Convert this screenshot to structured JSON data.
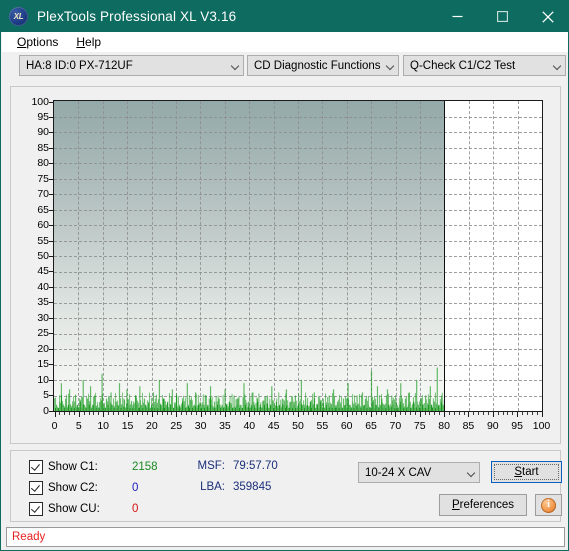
{
  "window": {
    "title": "PlexTools Professional XL V3.16",
    "logo_text": "XL",
    "minimize_label": "minimize",
    "maximize_label": "maximize",
    "close_label": "close"
  },
  "menubar": {
    "items": [
      {
        "label": "Options",
        "accel": "O"
      },
      {
        "label": "Help",
        "accel": "H"
      }
    ]
  },
  "toolbar": {
    "drive_select": "HA:8 ID:0  PX-712UF",
    "function_select": "CD Diagnostic Functions",
    "test_select": "Q-Check C1/C2 Test"
  },
  "info": {
    "checkboxes": [
      {
        "label": "Show C1:",
        "value": "2158",
        "checked": true,
        "color": "#1a8a22"
      },
      {
        "label": "Show C2:",
        "value": "0",
        "checked": true,
        "color": "#1b1bbd"
      },
      {
        "label": "Show CU:",
        "value": "0",
        "checked": true,
        "color": "#d41111"
      }
    ],
    "msf_label": "MSF:",
    "msf_value": "79:57.70",
    "lba_label": "LBA:",
    "lba_value": "359845",
    "speed_select": "10-24 X CAV",
    "start_label": "Start",
    "preferences_label": "Preferences",
    "info_icon_label": "i"
  },
  "statusbar": {
    "text": "Ready"
  },
  "chart_data": {
    "type": "bar",
    "title": "",
    "xlabel": "",
    "ylabel": "",
    "xlim": [
      0,
      100
    ],
    "ylim": [
      0,
      100
    ],
    "xticks": [
      0,
      5,
      10,
      15,
      20,
      25,
      30,
      35,
      40,
      45,
      50,
      55,
      60,
      65,
      70,
      75,
      80,
      85,
      90,
      95,
      100
    ],
    "yticks": [
      0,
      5,
      10,
      15,
      20,
      25,
      30,
      35,
      40,
      45,
      50,
      55,
      60,
      65,
      70,
      75,
      80,
      85,
      90,
      95,
      100
    ],
    "grid": true,
    "legend": "none",
    "data_end_x": 80,
    "series": [
      {
        "name": "C1",
        "color": "#1a9a1f",
        "x_unit": "percent of disc",
        "x": [
          0.2,
          0.5,
          0.8,
          1.1,
          1.4,
          1.7,
          2.0,
          2.3,
          2.6,
          2.9,
          3.2,
          3.5,
          3.8,
          4.1,
          4.4,
          4.7,
          5.0,
          5.3,
          5.6,
          5.9,
          6.2,
          6.5,
          6.8,
          7.1,
          7.4,
          7.7,
          8.0,
          8.3,
          8.6,
          8.9,
          9.2,
          9.5,
          9.8,
          10.1,
          10.4,
          10.7,
          11.0,
          11.3,
          11.6,
          11.9,
          12.2,
          12.5,
          12.8,
          13.1,
          13.4,
          13.7,
          14.0,
          14.3,
          14.6,
          14.9,
          15.2,
          15.5,
          15.8,
          16.1,
          16.4,
          16.7,
          17.0,
          17.3,
          17.6,
          17.9,
          18.2,
          18.5,
          18.8,
          19.1,
          19.4,
          19.7,
          20.0,
          20.3,
          20.6,
          20.9,
          21.2,
          21.5,
          21.8,
          22.1,
          22.4,
          22.7,
          23.0,
          23.3,
          23.6,
          23.9,
          24.2,
          24.5,
          24.8,
          25.1,
          25.4,
          25.7,
          26.0,
          26.3,
          26.6,
          26.9,
          27.2,
          27.5,
          27.8,
          28.1,
          28.4,
          28.7,
          29.0,
          29.3,
          29.6,
          29.9,
          30.2,
          30.5,
          30.8,
          31.1,
          31.4,
          31.7,
          32.0,
          32.3,
          32.6,
          32.9,
          33.2,
          33.5,
          33.8,
          34.1,
          34.4,
          34.7,
          35.0,
          35.3,
          35.6,
          35.9,
          36.2,
          36.5,
          36.8,
          37.1,
          37.4,
          37.7,
          38.0,
          38.3,
          38.6,
          38.9,
          39.2,
          39.5,
          39.8,
          40.1,
          40.4,
          40.7,
          41.0,
          41.3,
          41.6,
          41.9,
          42.2,
          42.5,
          42.8,
          43.1,
          43.4,
          43.7,
          44.0,
          44.3,
          44.6,
          44.9,
          45.2,
          45.5,
          45.8,
          46.1,
          46.4,
          46.7,
          47.0,
          47.3,
          47.6,
          47.9,
          48.2,
          48.5,
          48.8,
          49.1,
          49.4,
          49.7,
          50.0,
          50.3,
          50.6,
          50.9,
          51.2,
          51.5,
          51.8,
          52.1,
          52.4,
          52.7,
          53.0,
          53.3,
          53.6,
          53.9,
          54.2,
          54.5,
          54.8,
          55.1,
          55.4,
          55.7,
          56.0,
          56.3,
          56.6,
          56.9,
          57.2,
          57.5,
          57.8,
          58.1,
          58.4,
          58.7,
          59.0,
          59.3,
          59.6,
          59.9,
          60.2,
          60.5,
          60.8,
          61.1,
          61.4,
          61.7,
          62.0,
          62.3,
          62.6,
          62.9,
          63.2,
          63.5,
          63.8,
          64.1,
          64.4,
          64.7,
          65.0,
          65.3,
          65.6,
          65.9,
          66.2,
          66.5,
          66.8,
          67.1,
          67.4,
          67.7,
          68.0,
          68.3,
          68.6,
          68.9,
          69.2,
          69.5,
          69.8,
          70.1,
          70.4,
          70.7,
          71.0,
          71.3,
          71.6,
          71.9,
          72.2,
          72.5,
          72.8,
          73.1,
          73.4,
          73.7,
          74.0,
          74.3,
          74.6,
          74.9,
          75.2,
          75.5,
          75.8,
          76.1,
          76.4,
          76.7,
          77.0,
          77.3,
          77.6,
          77.9,
          78.2,
          78.5,
          78.8,
          79.1,
          79.4,
          79.7
        ],
        "values": [
          1,
          2,
          1,
          3,
          9,
          2,
          1,
          4,
          1,
          2,
          7,
          1,
          2,
          1,
          5,
          2,
          1,
          3,
          1,
          10,
          2,
          1,
          4,
          2,
          8,
          1,
          2,
          5,
          1,
          2,
          1,
          3,
          12,
          2,
          1,
          4,
          2,
          1,
          6,
          2,
          1,
          3,
          1,
          2,
          9,
          1,
          2,
          4,
          1,
          7,
          2,
          1,
          3,
          2,
          1,
          5,
          2,
          1,
          8,
          2,
          1,
          4,
          2,
          1,
          3,
          1,
          2,
          6,
          1,
          2,
          1,
          10,
          2,
          1,
          4,
          1,
          2,
          3,
          1,
          2,
          7,
          1,
          2,
          5,
          1,
          2,
          1,
          3,
          2,
          1,
          9,
          2,
          1,
          4,
          1,
          2,
          6,
          1,
          2,
          3,
          1,
          2,
          1,
          5,
          2,
          1,
          8,
          2,
          1,
          3,
          1,
          2,
          4,
          1,
          2,
          1,
          7,
          2,
          1,
          3,
          2,
          1,
          5,
          1,
          2,
          4,
          1,
          2,
          1,
          9,
          2,
          1,
          3,
          1,
          2,
          6,
          2,
          1,
          4,
          1,
          2,
          1,
          3,
          2,
          1,
          5,
          1,
          2,
          8,
          1,
          2,
          3,
          1,
          2,
          1,
          4,
          2,
          1,
          7,
          2,
          1,
          3,
          1,
          2,
          5,
          1,
          2,
          1,
          10,
          2,
          1,
          4,
          2,
          1,
          3,
          1,
          2,
          6,
          1,
          2,
          1,
          3,
          2,
          4,
          1,
          2,
          1,
          5,
          2,
          1,
          7,
          1,
          2,
          3,
          1,
          2,
          1,
          4,
          2,
          1,
          9,
          2,
          1,
          3,
          1,
          2,
          5,
          1,
          2,
          1,
          6,
          2,
          4,
          1,
          2,
          1,
          13,
          3,
          1,
          2,
          8,
          1,
          2,
          4,
          1,
          2,
          1,
          7,
          2,
          1,
          5,
          2,
          1,
          3,
          1,
          2,
          9,
          2,
          1,
          4,
          1,
          2,
          6,
          1,
          2,
          3,
          1,
          10,
          2,
          1,
          4,
          2,
          1,
          5,
          1,
          2,
          8,
          2,
          1,
          3,
          1,
          14,
          2,
          1,
          5,
          2,
          1,
          3,
          2
        ]
      }
    ]
  }
}
